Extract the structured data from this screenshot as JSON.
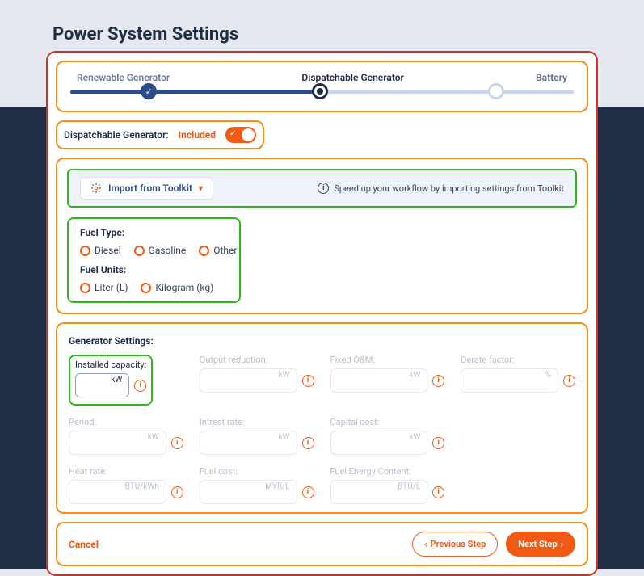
{
  "title": "Power System Settings",
  "stepper": {
    "steps": [
      "Renewable Generator",
      "Dispatchable Generator",
      "Battery"
    ]
  },
  "include": {
    "label": "Dispatchable Generator:",
    "state": "Included"
  },
  "import": {
    "button": "Import from Toolkit",
    "hint": "Speed up your workflow by importing settings from Toolkit"
  },
  "fuel": {
    "type_label": "Fuel Type:",
    "types": [
      "Diesel",
      "Gasoline",
      "Other"
    ],
    "units_label": "Fuel Units:",
    "units": [
      "Liter (L)",
      "Kilogram (kg)"
    ]
  },
  "gs": {
    "title": "Generator Settings:",
    "fields": {
      "installed": {
        "label": "Installed capacity:",
        "unit": "kW"
      },
      "output_red": {
        "label": "Output reduction:",
        "unit": "kW"
      },
      "fixed_om": {
        "label": "Fixed O&M:",
        "unit": "kW"
      },
      "derate": {
        "label": "Derate factor:",
        "unit": "%"
      },
      "period": {
        "label": "Period:",
        "unit": "kW"
      },
      "intrest": {
        "label": "Intrest rate:",
        "unit": "kW"
      },
      "capital": {
        "label": "Capital cost:",
        "unit": "kW"
      },
      "heat": {
        "label": "Heat rate:",
        "unit": "BTU/kWh"
      },
      "fuel_cost": {
        "label": "Fuel cost:",
        "unit": "MYR/L"
      },
      "fuel_energy": {
        "label": "Fuel Energy Content:",
        "unit": "BTU/L"
      }
    }
  },
  "footer": {
    "cancel": "Cancel",
    "prev": "Previous Step",
    "next": "Next Step"
  }
}
